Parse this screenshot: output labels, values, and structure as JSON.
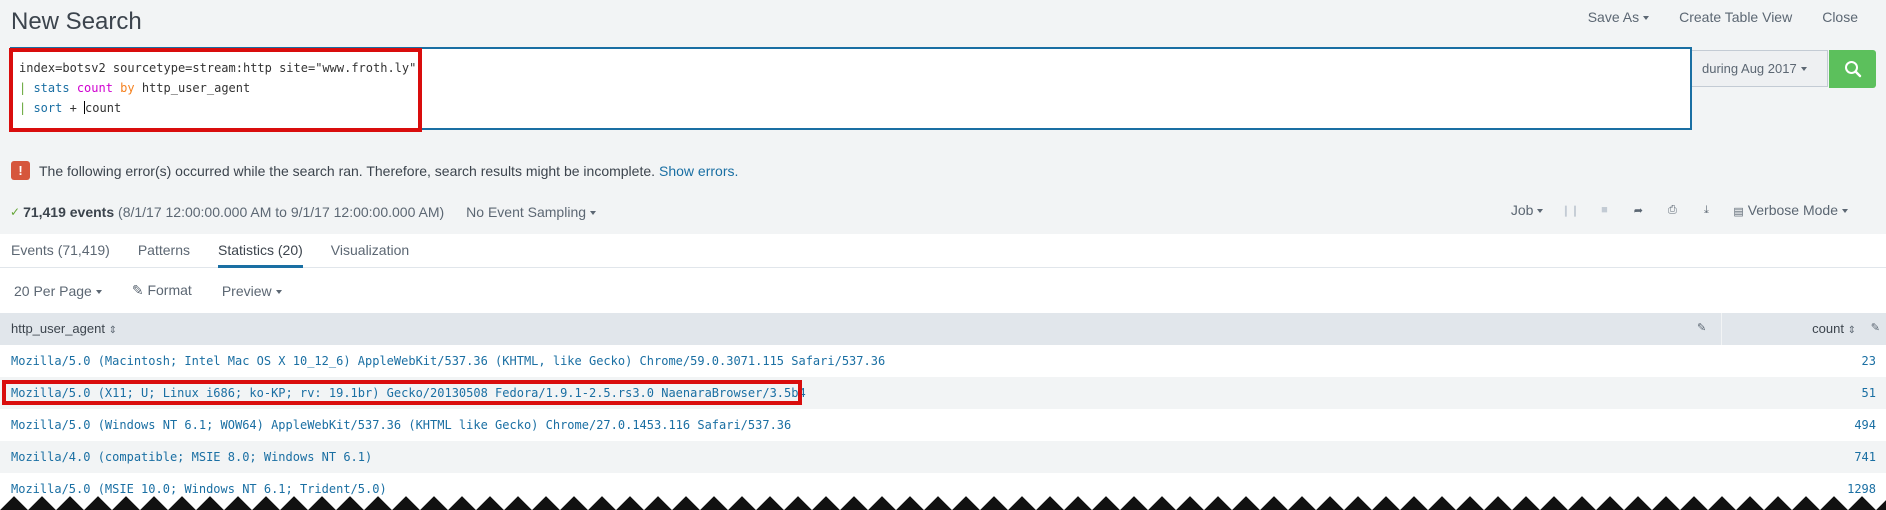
{
  "header": {
    "title": "New Search",
    "save_as": "Save As",
    "create_table_view": "Create Table View",
    "close": "Close"
  },
  "search": {
    "line1": "index=botsv2 sourcetype=stream:http site=\"www.froth.ly\"",
    "line2_pipe": "| ",
    "line2_cmd": "stats",
    "line2_fn": "count",
    "line2_by": "by",
    "line2_field": "http_user_agent",
    "line3_pipe": "| ",
    "line3_cmd": "sort",
    "line3_op": "+ ",
    "line3_field_start": "c",
    "line3_field_rest": "ount"
  },
  "time_picker": {
    "label": "during Aug 2017"
  },
  "error": {
    "message": "The following error(s) occurred while the search ran. Therefore, search results might be incomplete.",
    "link": "Show errors."
  },
  "status": {
    "events_count": "71,419 events",
    "range": "(8/1/17 12:00:00.000 AM to 9/1/17 12:00:00.000 AM)",
    "sampling": "No Event Sampling",
    "job": "Job",
    "mode": "Verbose Mode"
  },
  "tabs": [
    {
      "label": "Events (71,419)"
    },
    {
      "label": "Patterns"
    },
    {
      "label": "Statistics (20)"
    },
    {
      "label": "Visualization"
    }
  ],
  "toolbar": {
    "per_page": "20 Per Page",
    "format": "Format",
    "preview": "Preview"
  },
  "table": {
    "col_agent": "http_user_agent",
    "col_count": "count",
    "rows": [
      {
        "agent": "Mozilla/5.0 (Macintosh; Intel Mac OS X 10_12_6) AppleWebKit/537.36 (KHTML, like Gecko) Chrome/59.0.3071.115 Safari/537.36",
        "count": "23"
      },
      {
        "agent": "Mozilla/5.0 (X11; U; Linux i686; ko-KP; rv: 19.1br) Gecko/20130508 Fedora/1.9.1-2.5.rs3.0 NaenaraBrowser/3.5b4",
        "count": "51"
      },
      {
        "agent": "Mozilla/5.0 (Windows NT 6.1; WOW64) AppleWebKit/537.36 (KHTML like Gecko) Chrome/27.0.1453.116 Safari/537.36",
        "count": "494"
      },
      {
        "agent": "Mozilla/4.0 (compatible; MSIE 8.0; Windows NT 6.1)",
        "count": "741"
      },
      {
        "agent": "Mozilla/5.0 (MSIE 10.0; Windows NT 6.1; Trident/5.0)",
        "count": "1298"
      }
    ]
  },
  "colors": {
    "accent": "#1a6fa3",
    "search_button": "#5cc05c",
    "error": "#d6563c",
    "highlight": "#d90d0d"
  },
  "icons": {
    "search": "search-icon",
    "error": "error-icon",
    "pause": "pause-icon",
    "stop": "stop-icon",
    "share": "share-icon",
    "print": "print-icon",
    "export": "export-icon",
    "mode": "mode-icon",
    "format": "pencil-icon"
  }
}
